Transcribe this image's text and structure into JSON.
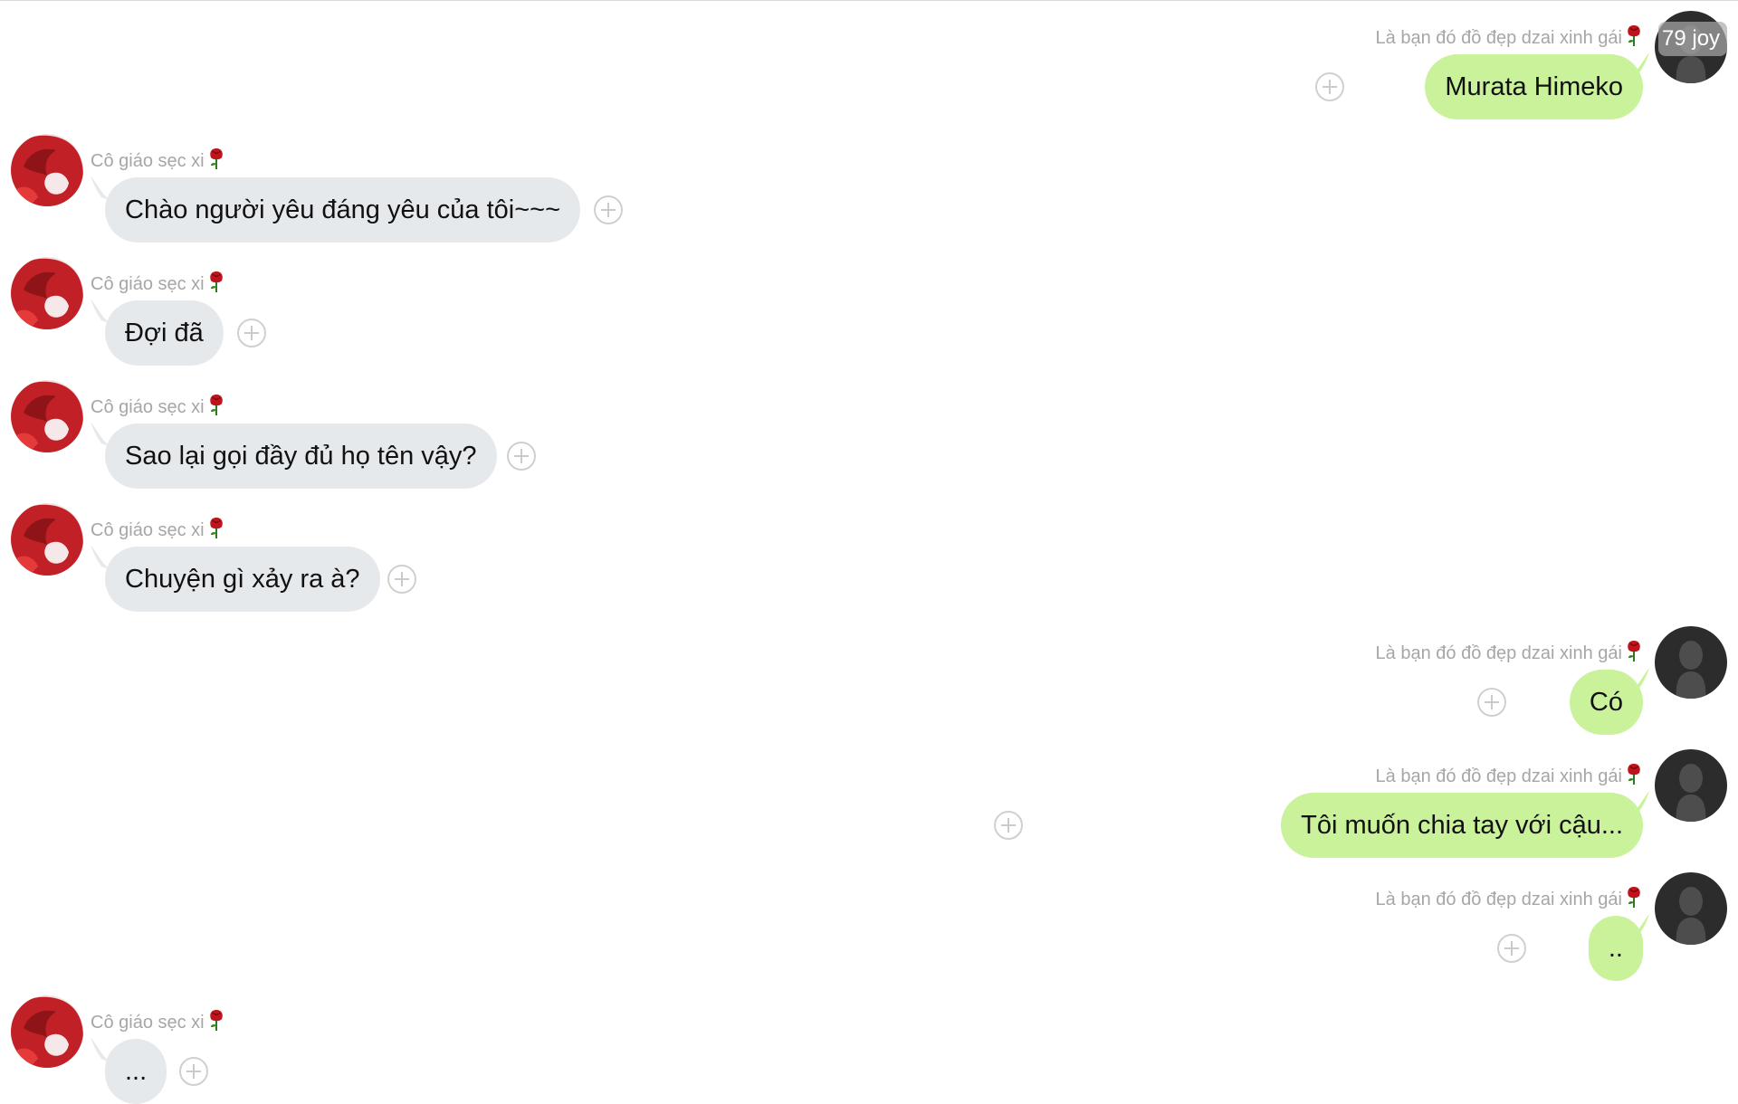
{
  "chat": {
    "colors": {
      "outgoing_bubble": "#c9f29b",
      "incoming_bubble": "#e6e9ec",
      "name_text": "#a6a6a6"
    },
    "messages": [
      {
        "side": "right",
        "sender": "Là bạn đó đồ đẹp dzai xinh gái",
        "text": "Murata Himeko",
        "avatar": "dark-silhouette",
        "avatar_badge": "79 joy"
      },
      {
        "side": "left",
        "sender": "Cô giáo sẹc xi",
        "text": "Chào người yêu đáng yêu của tôi~~~",
        "avatar": "red-hair-girl"
      },
      {
        "side": "left",
        "sender": "Cô giáo sẹc xi",
        "text": "Đợi đã",
        "avatar": "red-hair-girl"
      },
      {
        "side": "left",
        "sender": "Cô giáo sẹc xi",
        "text": "Sao lại gọi đầy đủ họ tên vậy?",
        "avatar": "red-hair-girl"
      },
      {
        "side": "left",
        "sender": "Cô giáo sẹc xi",
        "text": "Chuyện gì xảy ra à?",
        "avatar": "red-hair-girl"
      },
      {
        "side": "right",
        "sender": "Là bạn đó đồ đẹp dzai xinh gái",
        "text": "Có",
        "avatar": "dark-silhouette"
      },
      {
        "side": "right",
        "sender": "Là bạn đó đồ đẹp dzai xinh gái",
        "text": "Tôi muốn chia tay với cậu...",
        "avatar": "dark-silhouette"
      },
      {
        "side": "right",
        "sender": "Là bạn đó đồ đẹp dzai xinh gái",
        "text": "..",
        "avatar": "dark-silhouette"
      },
      {
        "side": "left",
        "sender": "Cô giáo sẹc xi",
        "text": "...",
        "avatar": "red-hair-girl"
      }
    ]
  }
}
